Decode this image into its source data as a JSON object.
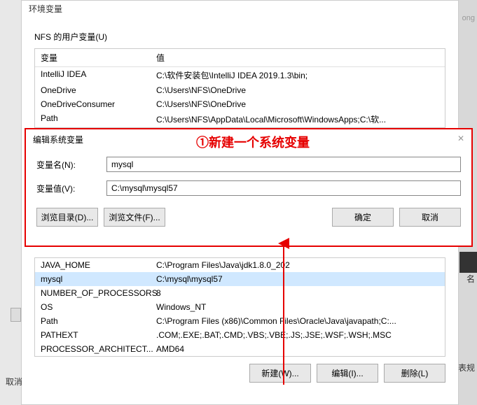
{
  "main_window": {
    "title": "环境变量"
  },
  "user_vars": {
    "label": "NFS 的用户变量(U)",
    "header_var": "变量",
    "header_val": "值",
    "rows": [
      {
        "var": "IntelliJ IDEA",
        "val": "C:\\软件安装包\\IntelliJ IDEA 2019.1.3\\bin;"
      },
      {
        "var": "OneDrive",
        "val": "C:\\Users\\NFS\\OneDrive"
      },
      {
        "var": "OneDriveConsumer",
        "val": "C:\\Users\\NFS\\OneDrive"
      },
      {
        "var": "Path",
        "val": "C:\\Users\\NFS\\AppData\\Local\\Microsoft\\WindowsApps;C:\\软..."
      }
    ]
  },
  "annotation": "①新建一个系统变量",
  "dialog": {
    "title": "编辑系统变量",
    "name_label": "变量名(N):",
    "name_value": "mysql",
    "value_label": "变量值(V):",
    "value_value": "C:\\mysql\\mysql57",
    "browse_dir": "浏览目录(D)...",
    "browse_file": "浏览文件(F)...",
    "ok": "确定",
    "cancel": "取消"
  },
  "sys_vars": {
    "rows": [
      {
        "var": "JAVA_HOME",
        "val": "C:\\Program Files\\Java\\jdk1.8.0_202"
      },
      {
        "var": "mysql",
        "val": "C:\\mysql\\mysql57",
        "selected": true
      },
      {
        "var": "NUMBER_OF_PROCESSORS",
        "val": "8"
      },
      {
        "var": "OS",
        "val": "Windows_NT"
      },
      {
        "var": "Path",
        "val": "C:\\Program Files (x86)\\Common Files\\Oracle\\Java\\javapath;C:..."
      },
      {
        "var": "PATHEXT",
        "val": ".COM;.EXE;.BAT;.CMD;.VBS;.VBE;.JS;.JSE;.WSF;.WSH;.MSC"
      },
      {
        "var": "PROCESSOR_ARCHITECT...",
        "val": "AMD64"
      }
    ]
  },
  "bottom": {
    "new": "新建(W)...",
    "edit": "编辑(I)...",
    "delete": "删除(L)"
  },
  "outer_cancel": "取消",
  "side1": "名",
  "side2": "表规",
  "side3": "ong"
}
